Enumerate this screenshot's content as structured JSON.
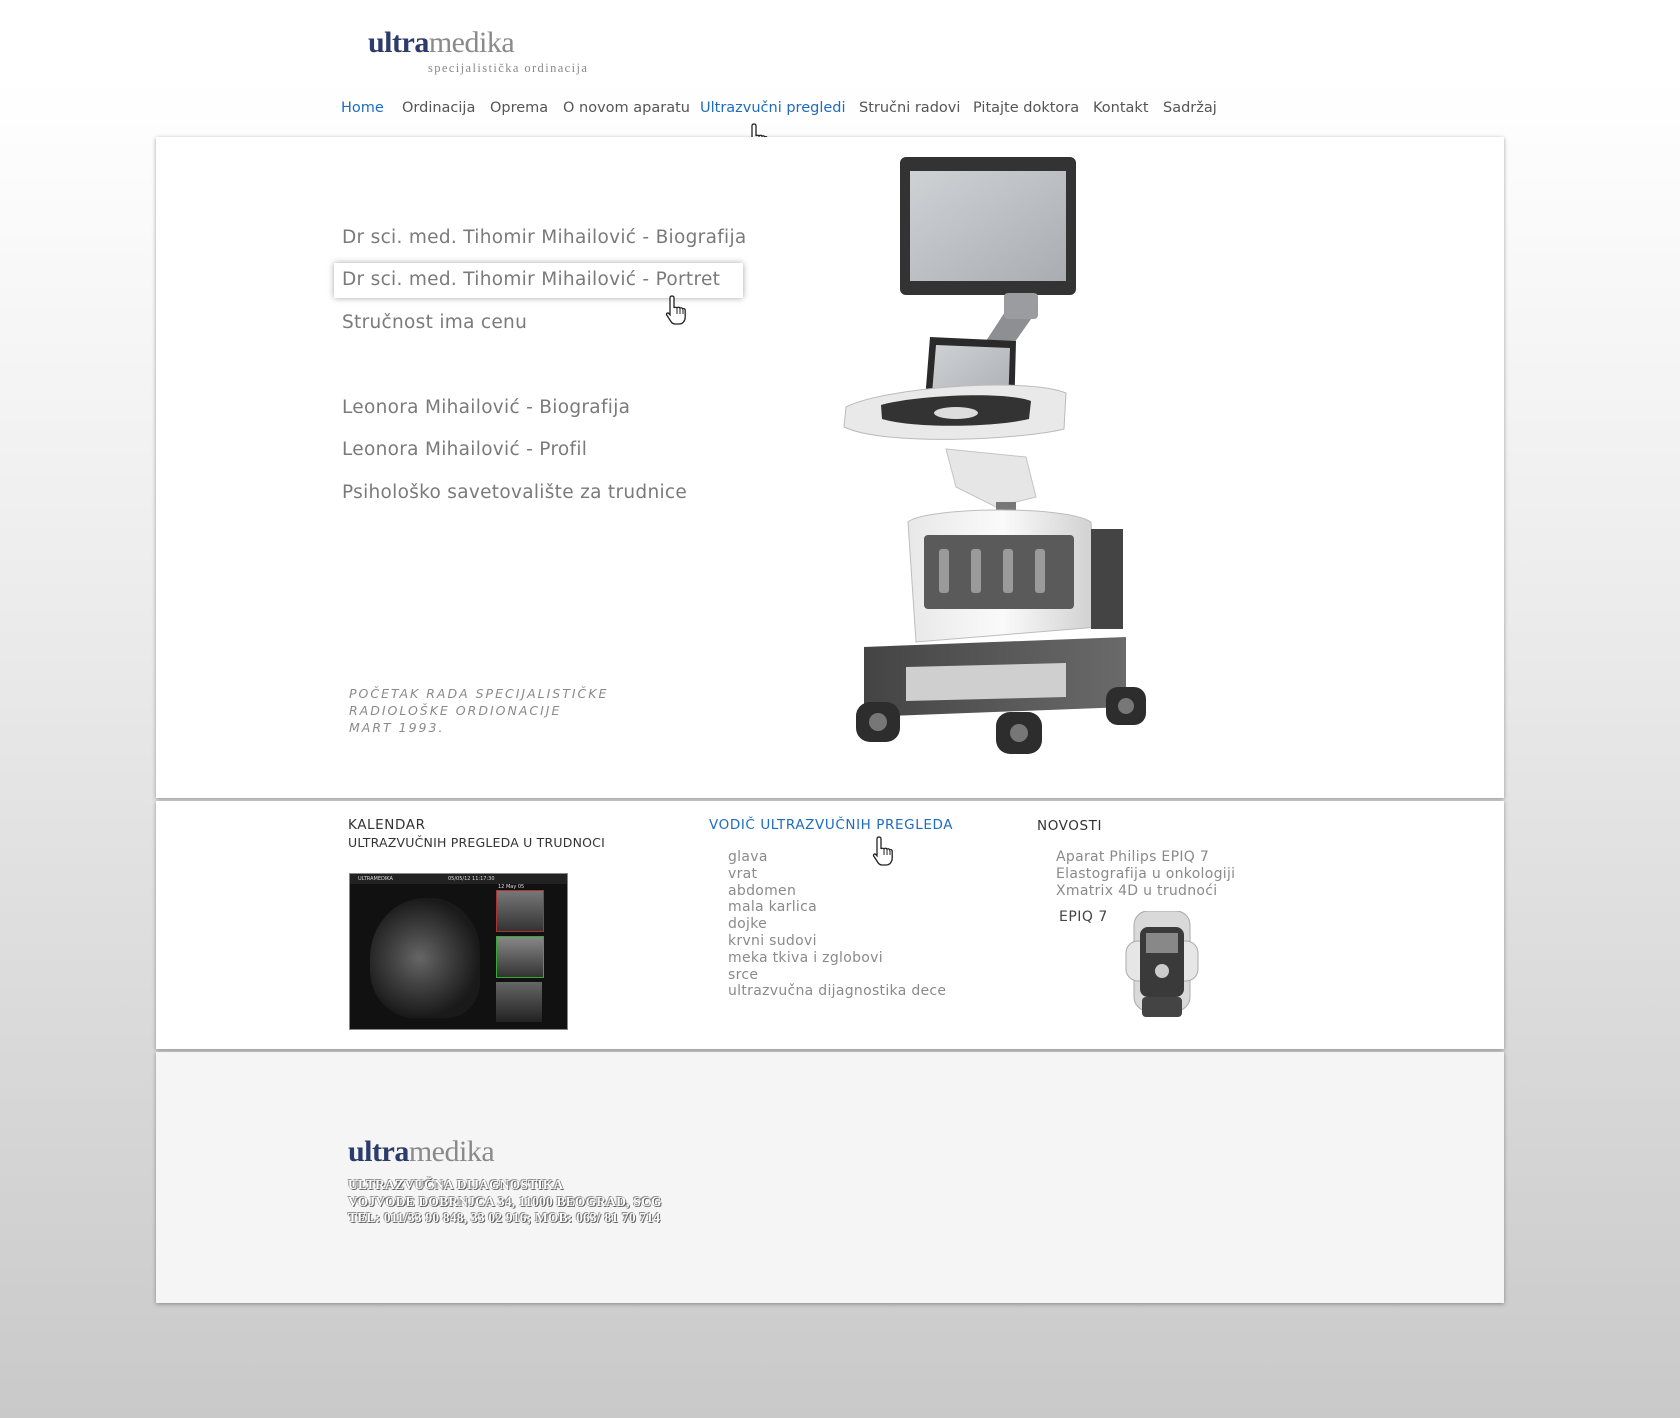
{
  "logo": {
    "brand_a": "ultra",
    "brand_b": "medika",
    "tagline": "specijalistička ordinacija"
  },
  "nav": [
    {
      "label": "Home",
      "active": true
    },
    {
      "label": "Ordinacija"
    },
    {
      "label": "Oprema"
    },
    {
      "label": "O novom aparatu"
    },
    {
      "label": "Ultrazvučni pregledi",
      "active": true
    },
    {
      "label": "Stručni radovi"
    },
    {
      "label": "Pitajte doktora"
    },
    {
      "label": "Kontakt"
    },
    {
      "label": "Sadržaj"
    }
  ],
  "side_links": [
    "Dr sci. med. Tihomir Mihailović - Biografija",
    "Dr sci. med. Tihomir Mihailović - Portret",
    "Stručnost ima cenu",
    "Leonora Mihailović - Biografija",
    "Leonora Mihailović - Profil",
    "Psihološko savetovalište za trudnice"
  ],
  "since": {
    "line1": "POČETAK RADA SPECIJALISTIČKE",
    "line2": "RADIOLOŠKE ORDIONACIJE",
    "line3": "MART 1993."
  },
  "calendar": {
    "line1": "KALENDAR",
    "line2": "ULTRAZVUČNIH PREGLEDA U TRUDNOCI"
  },
  "ultrasound_image": {
    "header": "ULTRAMEDIKA",
    "date": "05/05/12 11:17:30",
    "stamp": "12 May 05"
  },
  "guide": {
    "title": "VODIČ ULTRAZVUČNIH PREGLEDA",
    "items": [
      "glava",
      "vrat",
      "abdomen",
      "mala karlica",
      "dojke",
      "krvni sudovi",
      "meka tkiva i zglobovi",
      "srce",
      "ultrazvučna dijagnostika dece"
    ]
  },
  "news": {
    "title": "NOVOSTI",
    "items": [
      "Aparat Philips EPIQ 7",
      "Elastografija u onkologiji",
      "Xmatrix 4D u trudnoći"
    ],
    "epiq_label": "EPIQ 7"
  },
  "footer": {
    "logo_a": "ultra",
    "logo_b": "medika",
    "line1": "ULTRAZVUČNA DIJAGNOSTIKA",
    "line2": "VOJVODE DOBRNJCA 34, 11000 BEOGRAD, SCG",
    "line3": "TEL: 011/33 90 848, 33 02 916; MOB: 063/ 81 70 714"
  }
}
